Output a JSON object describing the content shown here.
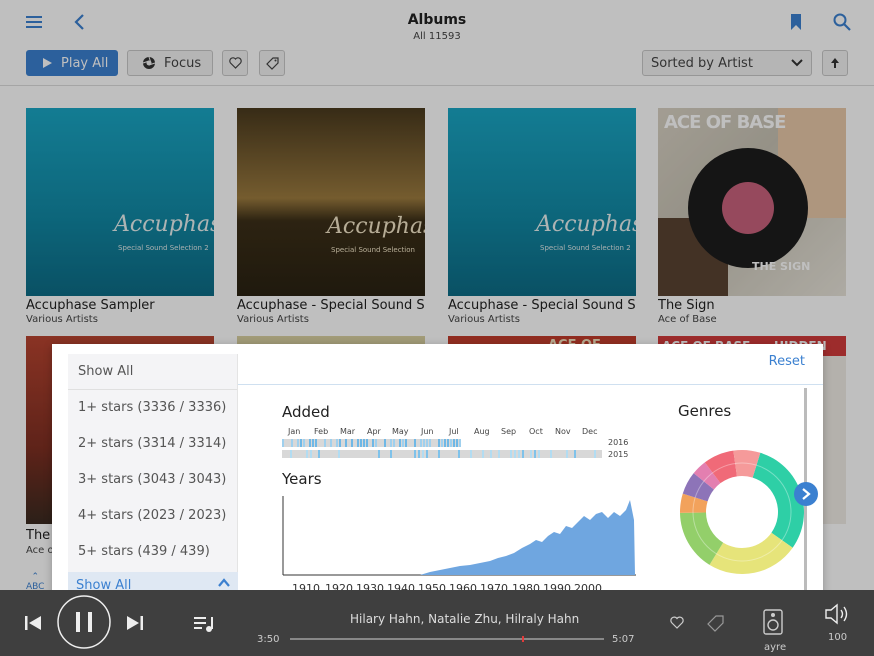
{
  "header": {
    "title": "Albums",
    "subtitle": "All 11593",
    "icons": [
      "menu-icon",
      "back-icon",
      "bookmark-icon",
      "search-icon"
    ]
  },
  "toolbar": {
    "play_all": "Play All",
    "focus": "Focus",
    "sort_label": "Sorted by Artist"
  },
  "albums": [
    {
      "title": "Accuphase Sampler",
      "artist": "Various Artists",
      "cover_text": "Accuphase",
      "cover_sub": "Special Sound Selection 2"
    },
    {
      "title": "Accuphase - Special Sound Sele",
      "artist": "Various Artists",
      "cover_text": "Accuphase",
      "cover_sub": "Special Sound Selection"
    },
    {
      "title": "Accuphase - Special Sound Sele",
      "artist": "Various Artists",
      "cover_text": "Accuphase",
      "cover_sub": "Special Sound Selection 2"
    },
    {
      "title": "The Sign",
      "artist": "Ace of Base",
      "cover_text": "ACE OF BASE",
      "cover_sub": "THE SIGN"
    }
  ],
  "row2": {
    "partial_title": "The",
    "partial_artist": "Ace o",
    "hidden_gems": "HIDDEN GEMS",
    "ace": "ACE OF BASE"
  },
  "abc_label": "ABC",
  "filter": {
    "reset": "Reset",
    "items": [
      "Show All",
      "1+ stars (3336 / 3336)",
      "2+ stars (3314 / 3314)",
      "3+ stars (3043 / 3043)",
      "4+ stars (2023 / 2023)",
      "5+ stars (439 / 439)"
    ],
    "selected": "Show All"
  },
  "added": {
    "label": "Added",
    "months": [
      "Jan",
      "Feb",
      "Mar",
      "Apr",
      "May",
      "Jun",
      "Jul",
      "Aug",
      "Sep",
      "Oct",
      "Nov",
      "Dec"
    ],
    "years": [
      "2016",
      "2015"
    ]
  },
  "years_chart": {
    "label": "Years",
    "ticks": [
      "1910",
      "1920",
      "1930",
      "1940",
      "1950",
      "1960",
      "1970",
      "1980",
      "1990",
      "2000"
    ]
  },
  "genres": {
    "label": "Genres",
    "colors": [
      "#2ecfa6",
      "#e6e47a",
      "#93cf6a",
      "#f2a25c",
      "#8d74b8",
      "#e37fb0",
      "#f06a78",
      "#f59a9a"
    ]
  },
  "player": {
    "now_playing": "Hilary Hahn, Natalie Zhu, Hilraly Hahn",
    "time_elapsed": "3:50",
    "time_total": "5:07",
    "zone": "ayre",
    "volume": "100"
  }
}
